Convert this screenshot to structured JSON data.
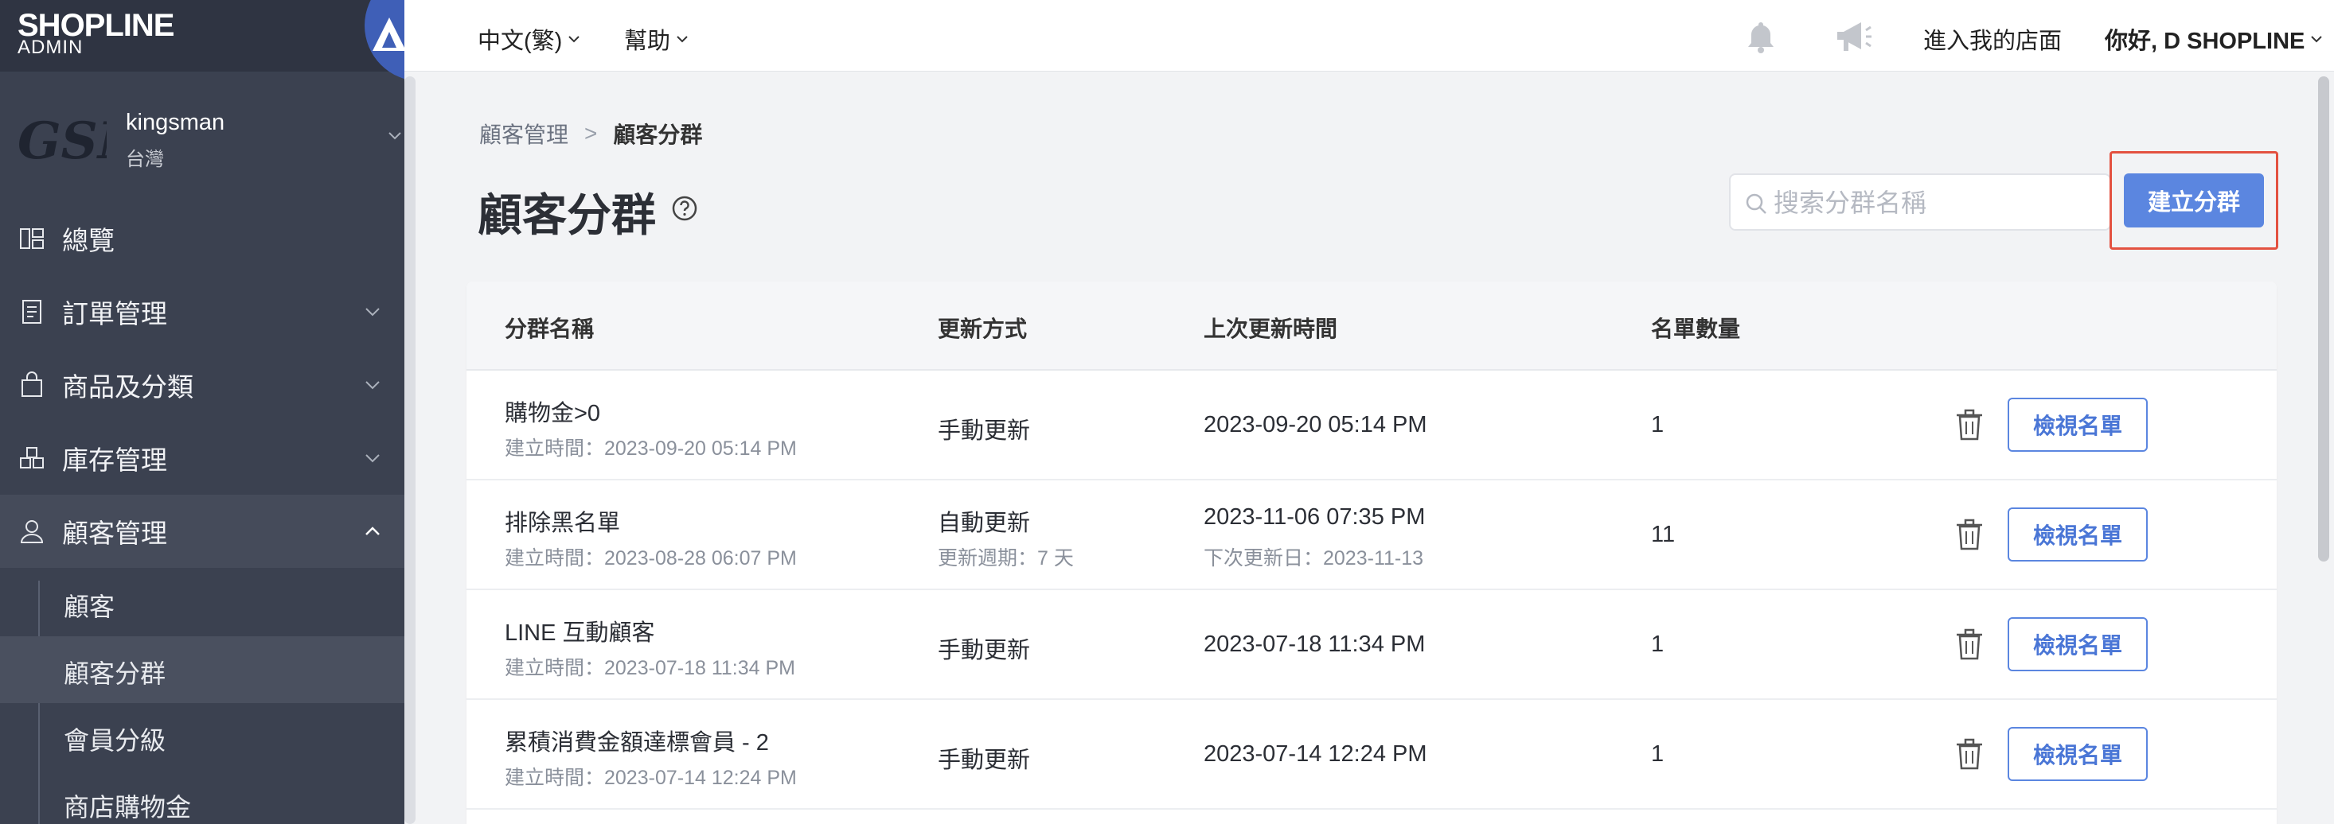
{
  "brand": {
    "name": "SHOPLINE",
    "sub": "ADMIN"
  },
  "store": {
    "logo_text": "GSM",
    "name": "kingsman",
    "region": "台灣"
  },
  "sidebar": {
    "items": [
      {
        "label": "總覽"
      },
      {
        "label": "訂單管理"
      },
      {
        "label": "商品及分類"
      },
      {
        "label": "庫存管理"
      },
      {
        "label": "顧客管理"
      }
    ],
    "sub_items": [
      {
        "label": "顧客"
      },
      {
        "label": "顧客分群"
      },
      {
        "label": "會員分級"
      },
      {
        "label": "商店購物金"
      }
    ]
  },
  "topbar": {
    "language": "中文(繁)",
    "help": "幫助",
    "visit_store": "進入我的店面",
    "greeting": "你好, D SHOPLINE"
  },
  "breadcrumb": {
    "parent": "顧客管理",
    "current": "顧客分群"
  },
  "page": {
    "title": "顧客分群"
  },
  "search": {
    "placeholder": "搜索分群名稱",
    "value": ""
  },
  "create_button": "建立分群",
  "table": {
    "headers": [
      "分群名稱",
      "更新方式",
      "上次更新時間",
      "名單數量"
    ],
    "view_label": "檢視名單",
    "rows": [
      {
        "name": "購物金>0",
        "created": "建立時間：2023-09-20 05:14 PM",
        "method": "手動更新",
        "method_sub": "",
        "updated": "2023-09-20 05:14 PM",
        "updated_sub": "",
        "count": "1"
      },
      {
        "name": "排除黑名單",
        "created": "建立時間：2023-08-28 06:07 PM",
        "method": "自動更新",
        "method_sub": "更新週期：7 天",
        "updated": "2023-11-06 07:35 PM",
        "updated_sub": "下次更新日：2023-11-13",
        "count": "11"
      },
      {
        "name": "LINE 互動顧客",
        "created": "建立時間：2023-07-18 11:34 PM",
        "method": "手動更新",
        "method_sub": "",
        "updated": "2023-07-18 11:34 PM",
        "updated_sub": "",
        "count": "1"
      },
      {
        "name": "累積消費金額達標會員 - 2",
        "created": "建立時間：2023-07-14 12:24 PM",
        "method": "手動更新",
        "method_sub": "",
        "updated": "2023-07-14 12:24 PM",
        "updated_sub": "",
        "count": "1"
      }
    ]
  },
  "colors": {
    "sidebar": "#3b4150",
    "primary": "#5b86e0",
    "highlight": "#e35140"
  }
}
